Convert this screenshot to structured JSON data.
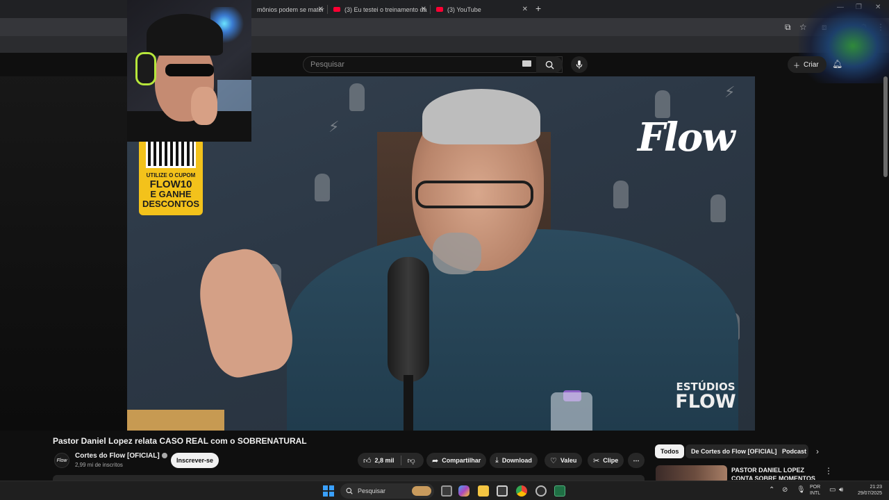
{
  "browser": {
    "tabs": [
      {
        "title": "mônios podem se mater"
      },
      {
        "title": "(3) Eu testei o treinamento da"
      },
      {
        "title": "(3) YouTube"
      }
    ],
    "new_tab_symbol": "+",
    "close_symbol": "✕",
    "window_controls": [
      "—",
      "❐",
      "✕"
    ]
  },
  "youtube": {
    "search_placeholder": "Pesquisar",
    "create_label": "Criar",
    "video": {
      "title": "Pastor Daniel Lopez relata CASO REAL com o SOBRENATURAL",
      "logo_text": "Flow",
      "studio_line1": "ESTÚDIOS",
      "studio_line2": "FLOW",
      "promo_line1": "UTILIZE O CUPOM",
      "promo_line2": "FLOW10",
      "promo_line3": "E GANHE",
      "promo_line4": "DESCONTOS"
    },
    "channel": {
      "name": "Cortes do Flow [OFICIAL]",
      "subscribers": "2,99 mi de inscritos",
      "subscribe_label": "Inscrever-se"
    },
    "actions": {
      "likes": "2,8 mil",
      "share": "Compartilhar",
      "download": "Download",
      "thanks": "Valeu",
      "clip": "Clipe",
      "more": "⋯"
    },
    "chips": [
      "Todos",
      "De Cortes do Flow [OFICIAL]",
      "Podcast"
    ],
    "recommendation": {
      "title": "PASTOR DANIEL LOPEZ CONTA SOBRE MOMENTOS"
    }
  },
  "taskbar": {
    "search_placeholder": "Pesquisar",
    "language_line1": "POR",
    "language_line2": "INTL",
    "time": "21:23",
    "date": "29/07/2025"
  },
  "colors": {
    "youtube_red": "#ff0033",
    "background": "#0f0f0f",
    "chip_bg": "#272727",
    "windows_blue": "#3aa0ff"
  }
}
